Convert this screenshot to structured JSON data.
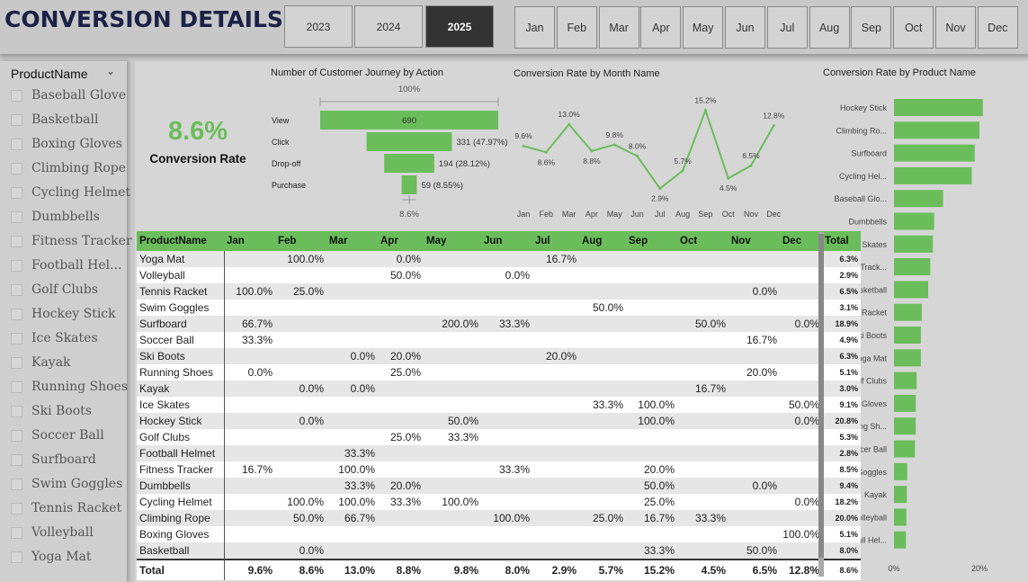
{
  "header": {
    "title": "CONVERSION DETAILS"
  },
  "years": [
    {
      "label": "2023",
      "selected": false
    },
    {
      "label": "2024",
      "selected": false
    },
    {
      "label": "2025",
      "selected": true
    }
  ],
  "months": [
    "Jan",
    "Feb",
    "Mar",
    "Apr",
    "May",
    "Jun",
    "Jul",
    "Aug",
    "Sep",
    "Oct",
    "Nov",
    "Dec"
  ],
  "slicer": {
    "title": "ProductName",
    "items": [
      "Baseball Glove",
      "Basketball",
      "Boxing Gloves",
      "Climbing Rope",
      "Cycling Helmet",
      "Dumbbells",
      "Fitness Tracker",
      "Football Hel...",
      "Golf Clubs",
      "Hockey Stick",
      "Ice Skates",
      "Kayak",
      "Running Shoes",
      "Ski Boots",
      "Soccer Ball",
      "Surfboard",
      "Swim Goggles",
      "Tennis Racket",
      "Volleyball",
      "Yoga Mat"
    ]
  },
  "kpi": {
    "value": "8.6%",
    "label": "Conversion Rate"
  },
  "colors": {
    "accent": "#6bbd5b",
    "text_dark": "#1b2147",
    "selected_year": "#333333"
  },
  "chart_data": [
    {
      "type": "bar",
      "subtype": "funnel",
      "title": "Number of Customer Journey by Action",
      "top_label": "100%",
      "bottom_label": "8.6%",
      "categories": [
        "View",
        "Click",
        "Drop-off",
        "Purchase"
      ],
      "values": [
        690,
        331,
        194,
        59
      ],
      "value_labels": [
        "690",
        "331 (47.97%)",
        "194 (28.12%)",
        "59 (8.55%)"
      ]
    },
    {
      "type": "line",
      "title": "Conversion Rate by Month Name",
      "x": [
        "Jan",
        "Feb",
        "Mar",
        "Apr",
        "May",
        "Jun",
        "Jul",
        "Aug",
        "Sep",
        "Oct",
        "Nov",
        "Dec"
      ],
      "values": [
        9.6,
        8.6,
        13.0,
        8.8,
        9.8,
        8.0,
        2.9,
        5.7,
        15.2,
        4.5,
        6.5,
        12.8
      ],
      "labels": [
        "9.6%",
        "8.6%",
        "13.0%",
        "8.8%",
        "9.8%",
        "8.0%",
        "2.9%",
        "5.7%",
        "15.2%",
        "4.5%",
        "6.5%",
        "12.8%"
      ],
      "ylim": [
        0,
        17
      ]
    },
    {
      "type": "bar",
      "orientation": "horizontal",
      "title": "Conversion Rate by Product Name",
      "categories": [
        "Hockey Stick",
        "Climbing Ro...",
        "Surfboard",
        "Cycling Hel...",
        "Baseball Glo...",
        "Dumbbells",
        "Ice Skates",
        "Fitness Track...",
        "Basketball",
        "Tennis Racket",
        "Ski Boots",
        "Yoga Mat",
        "Golf Clubs",
        "Boxing Gloves",
        "Running Sh...",
        "Soccer Ball",
        "Swim Goggles",
        "Kayak",
        "Volleyball",
        "Football Hel..."
      ],
      "values": [
        20.8,
        20.0,
        18.9,
        18.2,
        11.5,
        9.4,
        9.1,
        8.5,
        8.0,
        6.5,
        6.3,
        6.3,
        5.3,
        5.1,
        5.1,
        4.9,
        3.1,
        3.0,
        2.9,
        2.8
      ],
      "xticks": [
        "0%",
        "20%"
      ],
      "xlim": [
        0,
        22
      ]
    },
    {
      "type": "table",
      "columns": [
        "ProductName",
        "Jan",
        "Feb",
        "Mar",
        "Apr",
        "May",
        "Jun",
        "Jul",
        "Aug",
        "Sep",
        "Oct",
        "Nov",
        "Dec",
        "Total"
      ],
      "rows": [
        [
          "Yoga Mat",
          "",
          "100.0%",
          "",
          "0.0%",
          "",
          "",
          "16.7%",
          "",
          "",
          "",
          "",
          "",
          "6.3%"
        ],
        [
          "Volleyball",
          "",
          "",
          "",
          "50.0%",
          "",
          "0.0%",
          "",
          "",
          "",
          "",
          "",
          "",
          "2.9%"
        ],
        [
          "Tennis Racket",
          "100.0%",
          "25.0%",
          "",
          "",
          "",
          "",
          "",
          "",
          "",
          "",
          "0.0%",
          "",
          "6.5%"
        ],
        [
          "Swim Goggles",
          "",
          "",
          "",
          "",
          "",
          "",
          "",
          "50.0%",
          "",
          "",
          "",
          "",
          "3.1%"
        ],
        [
          "Surfboard",
          "66.7%",
          "",
          "",
          "",
          "200.0%",
          "33.3%",
          "",
          "",
          "",
          "50.0%",
          "",
          "0.0%",
          "18.9%"
        ],
        [
          "Soccer Ball",
          "33.3%",
          "",
          "",
          "",
          "",
          "",
          "",
          "",
          "",
          "",
          "16.7%",
          "",
          "4.9%"
        ],
        [
          "Ski Boots",
          "",
          "",
          "0.0%",
          "20.0%",
          "",
          "",
          "20.0%",
          "",
          "",
          "",
          "",
          "",
          "6.3%"
        ],
        [
          "Running Shoes",
          "0.0%",
          "",
          "",
          "25.0%",
          "",
          "",
          "",
          "",
          "",
          "",
          "20.0%",
          "",
          "5.1%"
        ],
        [
          "Kayak",
          "",
          "0.0%",
          "0.0%",
          "",
          "",
          "",
          "",
          "",
          "",
          "16.7%",
          "",
          "",
          "3.0%"
        ],
        [
          "Ice Skates",
          "",
          "",
          "",
          "",
          "",
          "",
          "",
          "33.3%",
          "100.0%",
          "",
          "",
          "50.0%",
          "9.1%"
        ],
        [
          "Hockey Stick",
          "",
          "0.0%",
          "",
          "",
          "50.0%",
          "",
          "",
          "",
          "100.0%",
          "",
          "",
          "0.0%",
          "20.8%"
        ],
        [
          "Golf Clubs",
          "",
          "",
          "",
          "25.0%",
          "33.3%",
          "",
          "",
          "",
          "",
          "",
          "",
          "",
          "5.3%"
        ],
        [
          "Football Helmet",
          "",
          "",
          "33.3%",
          "",
          "",
          "",
          "",
          "",
          "",
          "",
          "",
          "",
          "2.8%"
        ],
        [
          "Fitness Tracker",
          "16.7%",
          "",
          "100.0%",
          "",
          "",
          "33.3%",
          "",
          "",
          "20.0%",
          "",
          "",
          "",
          "8.5%"
        ],
        [
          "Dumbbells",
          "",
          "",
          "33.3%",
          "20.0%",
          "",
          "",
          "",
          "",
          "50.0%",
          "",
          "0.0%",
          "",
          "9.4%"
        ],
        [
          "Cycling Helmet",
          "",
          "100.0%",
          "100.0%",
          "33.3%",
          "100.0%",
          "",
          "",
          "",
          "25.0%",
          "",
          "",
          "0.0%",
          "18.2%"
        ],
        [
          "Climbing Rope",
          "",
          "50.0%",
          "66.7%",
          "",
          "",
          "100.0%",
          "",
          "25.0%",
          "16.7%",
          "33.3%",
          "",
          "",
          "20.0%"
        ],
        [
          "Boxing Gloves",
          "",
          "",
          "",
          "",
          "",
          "",
          "",
          "",
          "",
          "",
          "",
          "100.0%",
          "5.1%"
        ],
        [
          "Basketball",
          "",
          "0.0%",
          "",
          "",
          "",
          "",
          "",
          "",
          "33.3%",
          "",
          "50.0%",
          "",
          "8.0%"
        ]
      ],
      "total_row": [
        "Total",
        "9.6%",
        "8.6%",
        "13.0%",
        "8.8%",
        "9.8%",
        "8.0%",
        "2.9%",
        "5.7%",
        "15.2%",
        "4.5%",
        "6.5%",
        "12.8%",
        "8.6%"
      ]
    }
  ]
}
